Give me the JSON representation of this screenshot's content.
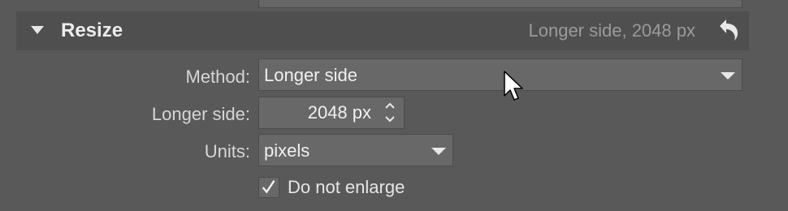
{
  "section": {
    "title": "Resize",
    "summary": "Longer side, 2048 px",
    "icons": {
      "collapse": "triangle-down-icon",
      "reset": "undo-arrow-icon"
    }
  },
  "fields": {
    "method": {
      "label": "Method:",
      "value": "Longer side"
    },
    "longer_side": {
      "label": "Longer side:",
      "value": "2048 px"
    },
    "units": {
      "label": "Units:",
      "value": "pixels"
    }
  },
  "do_not_enlarge": {
    "label": "Do not enlarge",
    "checked": true
  },
  "colors": {
    "background": "#595959",
    "header": "#4f4f4f",
    "field": "#686868",
    "text": "#e6e6e6"
  }
}
